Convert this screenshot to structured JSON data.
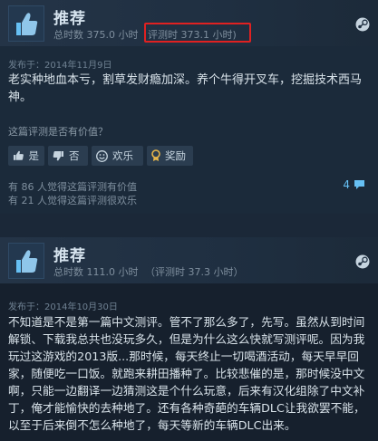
{
  "review1": {
    "recommend_label": "推荐",
    "hours_total": "总时数 375.0 小时",
    "hours_at_review": "评测时 373.1 小时)",
    "posted": "发布于：2014年11月9日",
    "content": "老实种地血本亏，割草发财瘾加深。养个牛得开叉车，挖掘技术西马神。",
    "helpful_question": "这篇评测是否有价值？",
    "buttons": {
      "yes": "是",
      "no": "否",
      "funny": "欢乐",
      "award": "奖励"
    },
    "helpful_count": "有 86 人觉得这篇评测有价值",
    "funny_count": "有 21 人觉得这篇评测很欢乐",
    "comment_count": "4"
  },
  "review2": {
    "recommend_label": "推荐",
    "hours_total": "总时数 111.0 小时",
    "hours_at_review": "（评测时 37.3 小时）",
    "posted": "发布于：2014年10月30日",
    "content": "不知道是不是第一篇中文测评。管不了那么多了，先写。虽然从到时间解锁、下载我总共也没玩多久，但是为什么这么快就写测评呢。因为我玩过这游戏的2013版...那时候，每天终止一切喝酒活动，每天早早回家，随便吃一口饭。就跑来耕田播种了。比较悲催的是，那时候没中文啊，只能一边翻译一边猜测这是个什么玩意，后来有汉化组除了中文补丁，俺才能愉快的去种地了。还有各种奇葩的车辆DLC让我欲罢不能，以至于后来倒不怎么种地了，每天等新的车辆DLC出来。"
  },
  "icons": [
    "thumbs-up-icon",
    "steam-icon",
    "thumbs-down-icon",
    "smiley-icon",
    "award-icon",
    "comment-icon"
  ],
  "colors": {
    "background": "#1b2838",
    "header": "#243447",
    "highlight": "#e02121",
    "link": "#66c0f4"
  }
}
